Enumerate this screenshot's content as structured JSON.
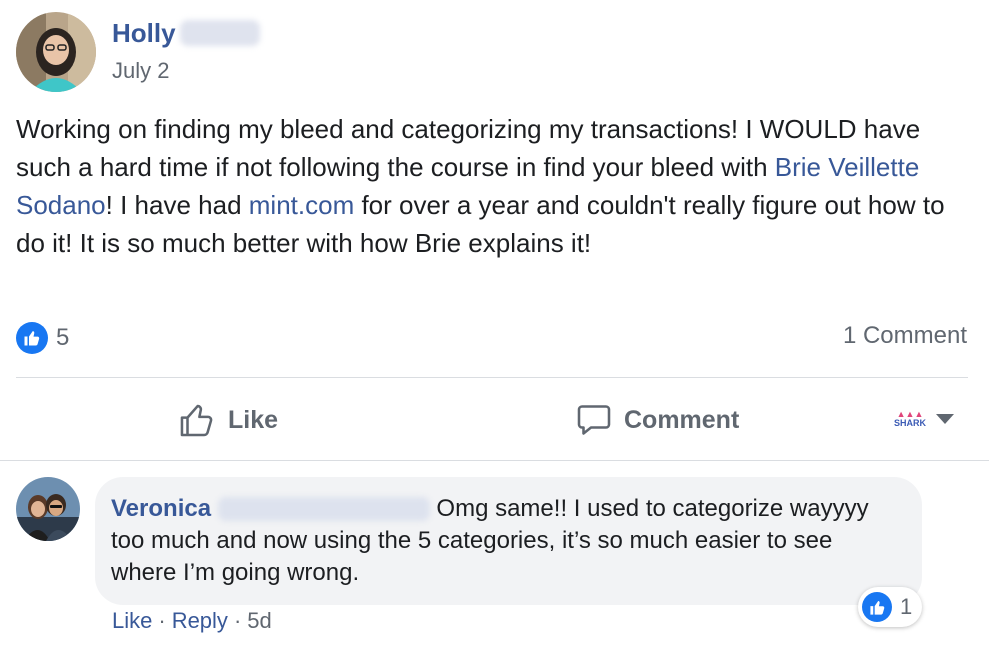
{
  "post": {
    "author_name": "Holly",
    "date": "July 2",
    "text_part1": "Working on finding my bleed and categorizing my transactions! I WOULD have such a hard time if not following the course in find your bleed with ",
    "mention": "Brie Veillette Sodano",
    "text_part2": "! I have had ",
    "link": "mint.com",
    "text_part3": " for over a year and couldn't really figure out how to do it! It is so much better with how Brie explains it!",
    "like_count": "5",
    "comment_count": "1 Comment"
  },
  "actions": {
    "like_label": "Like",
    "comment_label": "Comment",
    "profile_logo": "SHARK"
  },
  "comment": {
    "author_name": "Veronica",
    "text": "Omg same!! I used to categorize wayyyy too much and now using the 5 categories, it’s so much easier to see where I’m going wrong.",
    "reaction_count": "1",
    "like_label": "Like",
    "reply_label": "Reply",
    "separator": "·",
    "age": "5d"
  },
  "icons": {
    "like_reaction": "thumbs-up-icon",
    "like_action": "thumbs-up-outline-icon",
    "comment_action": "speech-bubble-icon",
    "dropdown": "caret-down-icon"
  },
  "colors": {
    "link": "#385898",
    "like_blue": "#1877f2",
    "secondary_text": "#606770",
    "bubble_bg": "#f2f3f5"
  }
}
